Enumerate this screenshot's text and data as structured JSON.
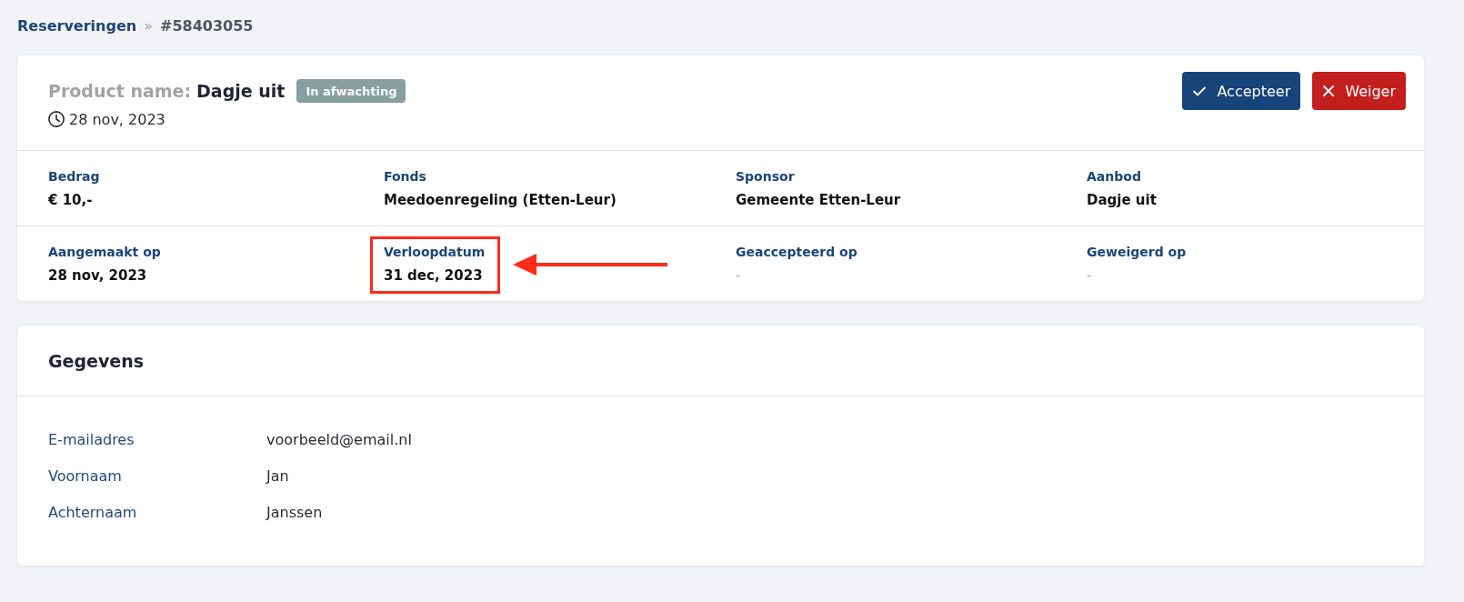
{
  "breadcrumb": {
    "items": [
      {
        "label": "Reserveringen",
        "kind": "link"
      },
      {
        "label": "#58403055",
        "kind": "current"
      }
    ],
    "separator": "»"
  },
  "reservation": {
    "title_label": "Product name:",
    "product_name": "Dagje uit",
    "status": {
      "label": "In afwachting",
      "kind": "pending"
    },
    "created_date": "28 nov, 2023",
    "actions": [
      {
        "label": "Accepteer",
        "kind": "accept"
      },
      {
        "label": "Weiger",
        "kind": "reject"
      }
    ],
    "details": [
      {
        "cells": [
          {
            "label": "Bedrag",
            "value": "€ 10,-",
            "empty": false,
            "highlighted": false
          },
          {
            "label": "Fonds",
            "value": "Meedoenregeling (Etten-Leur)",
            "empty": false,
            "highlighted": false
          },
          {
            "label": "Sponsor",
            "value": "Gemeente Etten-Leur",
            "empty": false,
            "highlighted": false
          },
          {
            "label": "Aanbod",
            "value": "Dagje uit",
            "empty": false,
            "highlighted": false
          }
        ]
      },
      {
        "cells": [
          {
            "label": "Aangemaakt op",
            "value": "28 nov, 2023",
            "empty": false,
            "highlighted": false
          },
          {
            "label": "Verloopdatum",
            "value": "31 dec, 2023",
            "empty": false,
            "highlighted": true
          },
          {
            "label": "Geaccepteerd op",
            "value": "-",
            "empty": true,
            "highlighted": false
          },
          {
            "label": "Geweigerd op",
            "value": "-",
            "empty": true,
            "highlighted": false
          }
        ]
      }
    ]
  },
  "personal_data": {
    "title": "Gegevens",
    "fields": [
      {
        "label": "E-mailadres",
        "value": "voorbeeld@email.nl"
      },
      {
        "label": "Voornaam",
        "value": "Jan"
      },
      {
        "label": "Achternaam",
        "value": "Janssen"
      }
    ]
  }
}
